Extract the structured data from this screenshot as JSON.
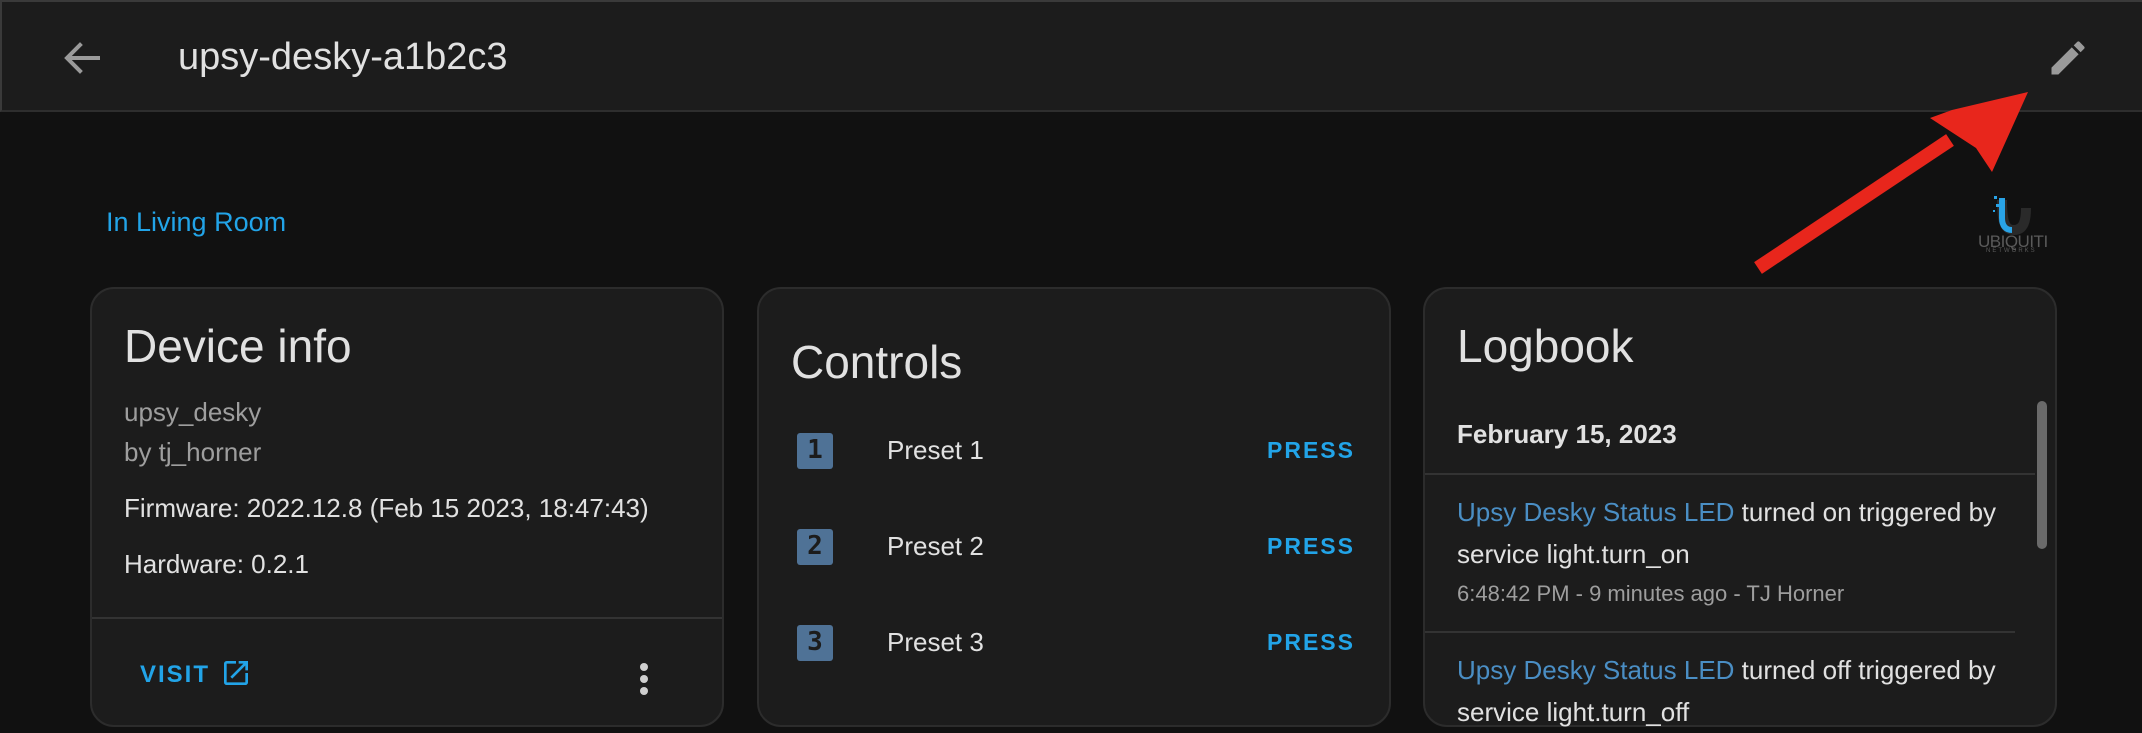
{
  "header": {
    "title": "upsy-desky-a1b2c3"
  },
  "area": {
    "label": "In Living Room"
  },
  "brand": {
    "name": "UBIQUITI",
    "sub": "NETWORKS"
  },
  "device_info": {
    "title": "Device info",
    "model": "upsy_desky",
    "manufacturer": "by tj_horner",
    "firmware": "Firmware: 2022.12.8 (Feb 15 2023, 18:47:43)",
    "hardware": "Hardware: 0.2.1",
    "visit_label": "VISIT"
  },
  "controls": {
    "title": "Controls",
    "items": [
      {
        "icon_text": "1",
        "label": "Preset 1",
        "action": "PRESS"
      },
      {
        "icon_text": "2",
        "label": "Preset 2",
        "action": "PRESS"
      },
      {
        "icon_text": "3",
        "label": "Preset 3",
        "action": "PRESS"
      }
    ]
  },
  "logbook": {
    "title": "Logbook",
    "date": "February 15, 2023",
    "entries": [
      {
        "entity": "Upsy Desky Status LED",
        "text": "turned on triggered by service light.turn_on",
        "meta": "6:48:42 PM - 9 minutes ago - TJ Horner"
      },
      {
        "entity": "Upsy Desky Status LED",
        "text": "turned off triggered by service light.turn_off",
        "meta": ""
      }
    ]
  },
  "colors": {
    "accent": "#22a4e8",
    "entity": "#4a8ec4",
    "annotation_arrow": "#e8261c"
  }
}
